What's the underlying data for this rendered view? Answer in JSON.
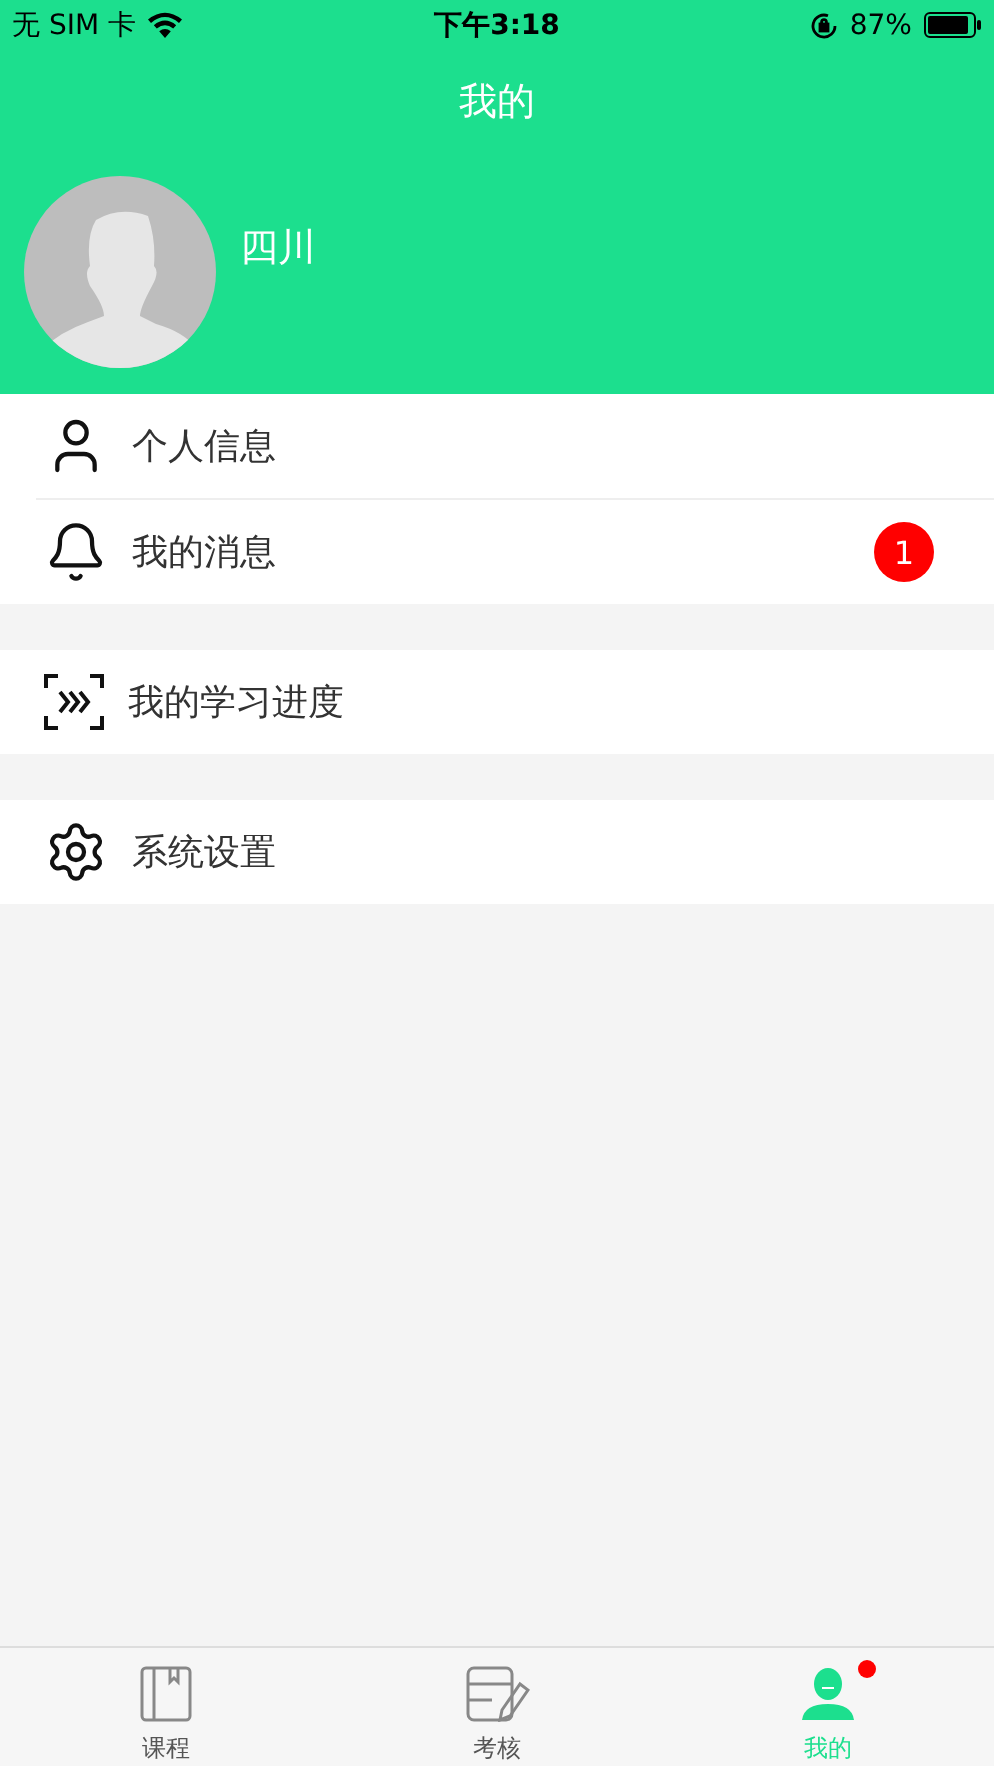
{
  "status_bar": {
    "carrier": "无 SIM 卡",
    "time": "下午3:18",
    "battery": "87%"
  },
  "nav": {
    "title": "我的"
  },
  "profile": {
    "name": "四川"
  },
  "groups": [
    [
      {
        "label": "个人信息"
      },
      {
        "label": "我的消息",
        "badge": "1"
      }
    ],
    [
      {
        "label": "我的学习进度"
      }
    ],
    [
      {
        "label": "系统设置"
      }
    ]
  ],
  "tabs": [
    {
      "label": "课程",
      "selected": false,
      "dot": false
    },
    {
      "label": "考核",
      "selected": false,
      "dot": false
    },
    {
      "label": "我的",
      "selected": true,
      "dot": true
    }
  ]
}
